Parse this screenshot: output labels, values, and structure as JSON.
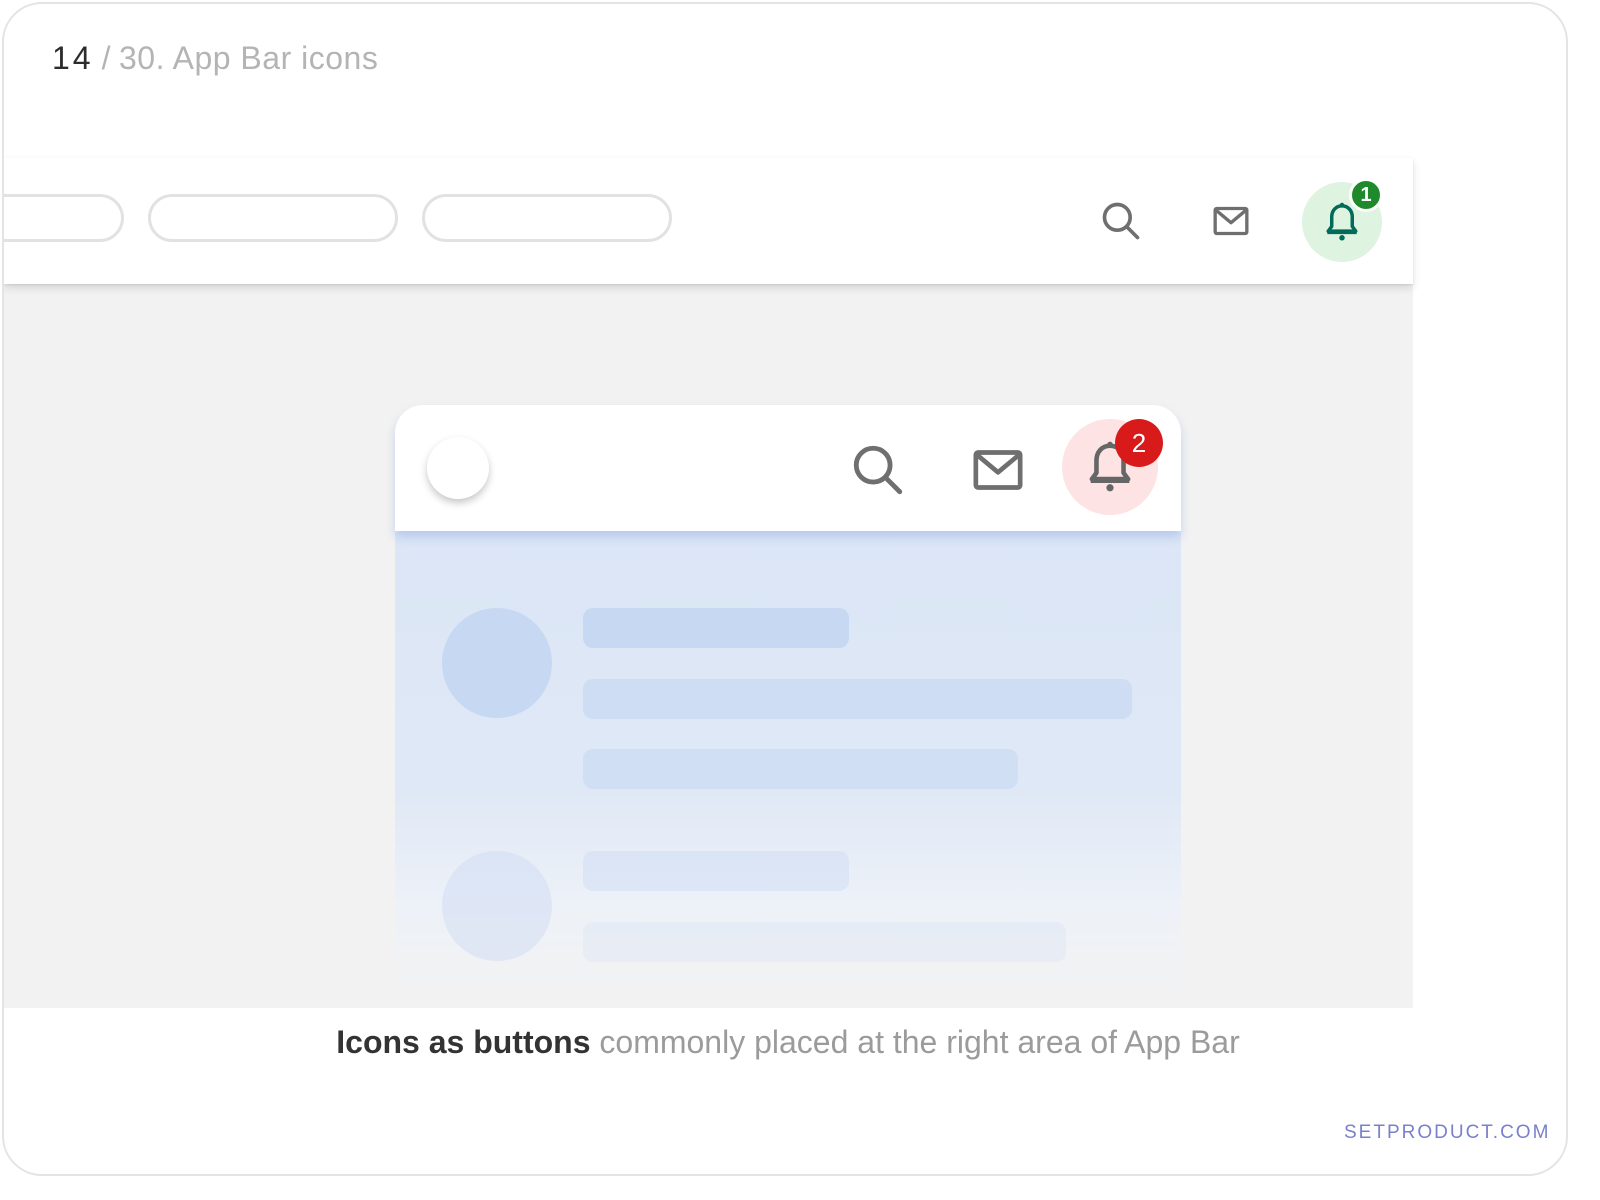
{
  "slide": {
    "counter_current": "14",
    "counter_separator": "/",
    "counter_rest": "30. App Bar icons"
  },
  "top_app_bar": {
    "icons": [
      "search-icon",
      "mail-icon",
      "bell-icon"
    ],
    "notification_badge": "1",
    "active_color": "#006b5b",
    "badge_color": "#1e8a2c",
    "active_bg": "#dff3e1"
  },
  "mobile_app_bar": {
    "icons": [
      "search-icon",
      "mail-icon",
      "bell-icon"
    ],
    "notification_badge": "2",
    "badge_color": "#d81a1a",
    "active_bg": "#fde3e3"
  },
  "caption": {
    "strong": "Icons as buttons",
    "rest": "commonly placed at the right area of App Bar"
  },
  "brand": "SETPRODUCT.COM"
}
